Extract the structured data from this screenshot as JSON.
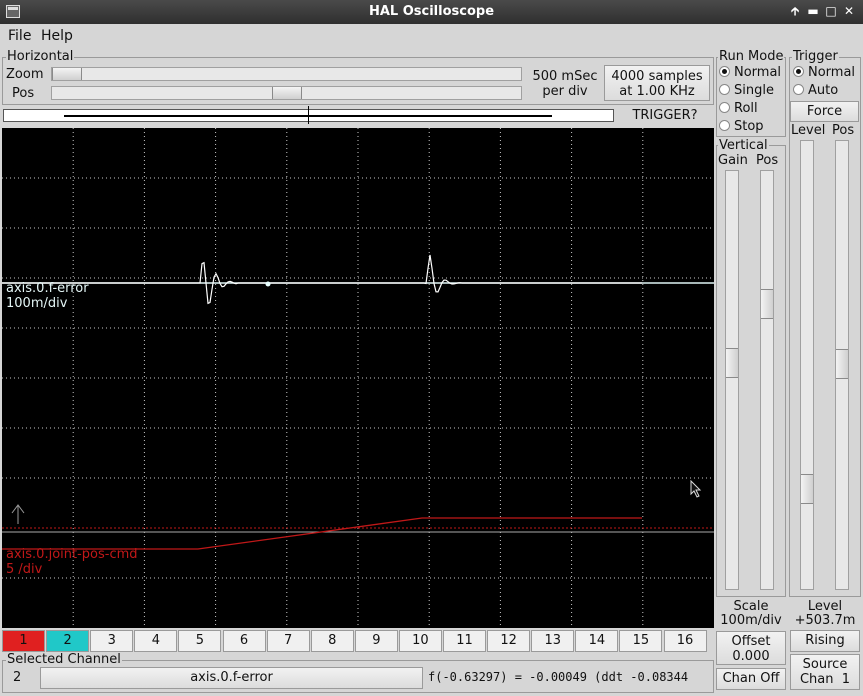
{
  "window": {
    "title": "HAL Oscilloscope"
  },
  "menu": {
    "file": "File",
    "help": "Help"
  },
  "horizontal": {
    "legend": "Horizontal",
    "zoom_label": "Zoom",
    "pos_label": "Pos",
    "zoom_value": 0.0,
    "pos_value": 0.5,
    "rate_line1": "500 mSec",
    "rate_line2": "per div",
    "samples_line1": "4000 samples",
    "samples_line2": "at 1.00 KHz",
    "trigger_status": "TRIGGER?"
  },
  "run_mode": {
    "legend": "Run Mode",
    "options": [
      "Normal",
      "Single",
      "Roll",
      "Stop"
    ],
    "selected": "Normal"
  },
  "trigger": {
    "legend": "Trigger",
    "options": [
      "Normal",
      "Auto"
    ],
    "selected": "Normal",
    "force_label": "Force",
    "level_header": "Level",
    "pos_header": "Pos",
    "level_caption": "Level",
    "level_value": "+503.7m",
    "edge_button": "Rising",
    "source_line1": "Source",
    "source_line2": "Chan  1"
  },
  "vertical": {
    "legend": "Vertical",
    "gain_header": "Gain",
    "pos_header": "Pos",
    "scale_caption": "Scale",
    "scale_value": "100m/div",
    "offset_line1": "Offset",
    "offset_line2": "0.000",
    "chan_off": "Chan Off"
  },
  "traces": [
    {
      "name": "axis.0.f-error",
      "scale": "100m/div",
      "color": "#d8f4f4"
    },
    {
      "name": "axis.0.joint-pos-cmd",
      "scale": "5 /div",
      "color": "#c01818"
    }
  ],
  "channels": {
    "buttons": [
      "1",
      "2",
      "3",
      "4",
      "5",
      "6",
      "7",
      "8",
      "9",
      "10",
      "11",
      "12",
      "13",
      "14",
      "15",
      "16"
    ],
    "active_colors": {
      "1": "#e02020",
      "2": "#20c8c8"
    }
  },
  "selected_channel": {
    "legend": "Selected Channel",
    "number": "2",
    "pin_name": "axis.0.f-error",
    "readout": "f(-0.63297) = -0.00049 (ddt -0.08344"
  },
  "colors": {
    "trace_cyan": "#d8f4f4",
    "trace_red": "#c01818",
    "grid": "#c8c8c8"
  }
}
